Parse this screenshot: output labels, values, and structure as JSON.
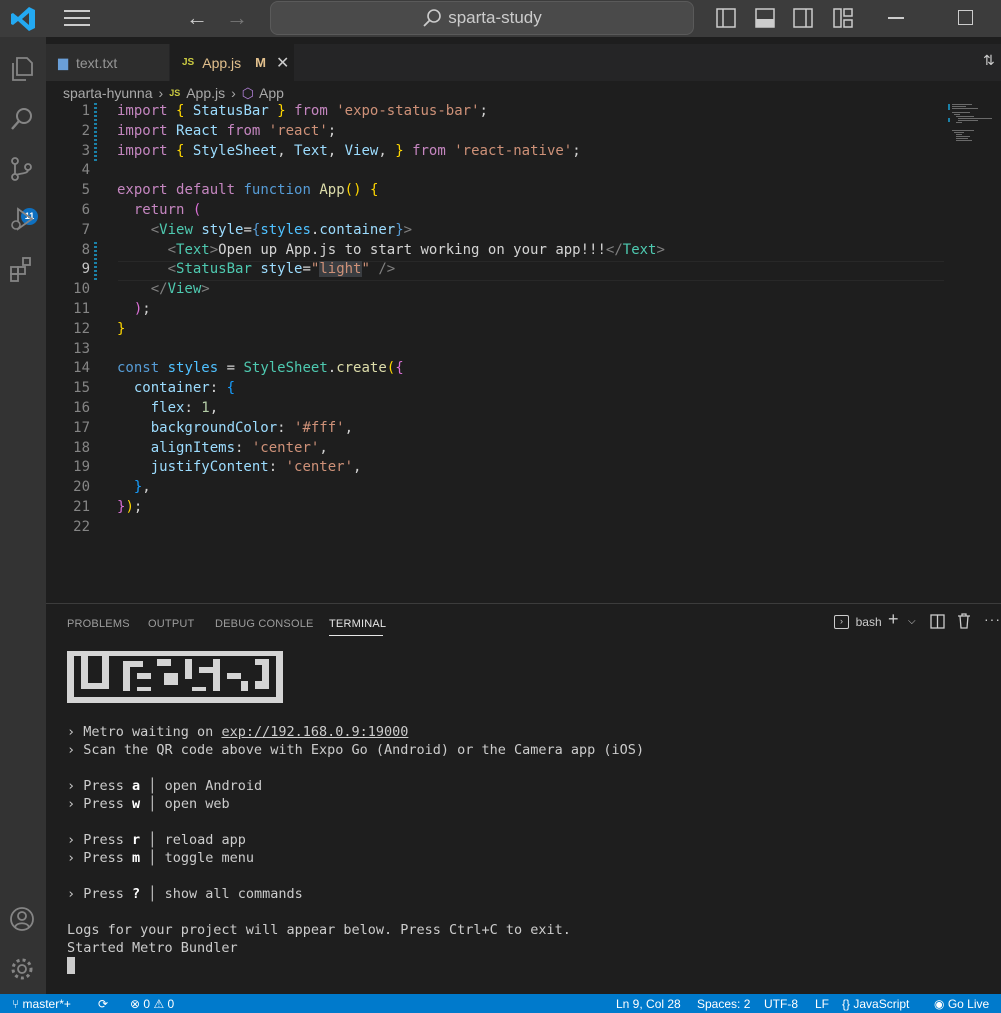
{
  "window": {
    "search_text": "sparta-study"
  },
  "tabs": [
    {
      "label": "text.txt",
      "icon": "text-file-icon"
    },
    {
      "label": "App.js",
      "icon": "js-file-icon",
      "status": "M"
    }
  ],
  "breadcrumb": {
    "folder": "sparta-hyunna",
    "file": "App.js",
    "symbol": "App"
  },
  "editor": {
    "active_line": 9,
    "line_numbers": [
      "1",
      "2",
      "3",
      "4",
      "5",
      "6",
      "7",
      "8",
      "9",
      "10",
      "11",
      "12",
      "13",
      "14",
      "15",
      "16",
      "17",
      "18",
      "19",
      "20",
      "21",
      "22"
    ]
  },
  "panel": {
    "tabs": [
      "PROBLEMS",
      "OUTPUT",
      "DEBUG CONSOLE",
      "TERMINAL"
    ],
    "active_tab": "TERMINAL",
    "shell_label": "bash"
  },
  "terminal": {
    "metro_prefix": "› Metro waiting on ",
    "metro_url": "exp://192.168.0.9:19000",
    "scan_line": "› Scan the QR code above with Expo Go (Android) or the Camera app (iOS)",
    "commands": [
      {
        "key": "a",
        "desc": "open Android"
      },
      {
        "key": "w",
        "desc": "open web"
      },
      {
        "key": "r",
        "desc": "reload app"
      },
      {
        "key": "m",
        "desc": "toggle menu"
      },
      {
        "key": "?",
        "desc": "show all commands"
      }
    ],
    "logs_line": "Logs for your project will appear below. Press Ctrl+C to exit.",
    "started_line": "Started Metro Bundler"
  },
  "statusbar": {
    "branch": "master*+",
    "errors": "0",
    "warnings": "0",
    "position": "Ln 9, Col 28",
    "spaces": "Spaces: 2",
    "encoding": "UTF-8",
    "eol": "LF",
    "language": "JavaScript",
    "golive": "Go Live"
  },
  "activity_badge": "11",
  "colors": {
    "statusbar": "#007acc",
    "accent": "#0e70c0"
  }
}
